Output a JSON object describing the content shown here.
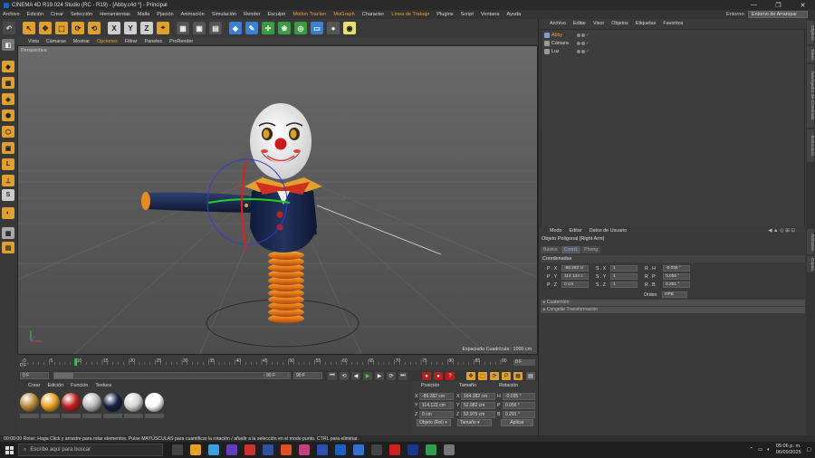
{
  "window": {
    "title": "CINEMA 4D R19.024 Studio (RC - R19) - [Abby.c4d *] - Principal",
    "controls": [
      "—",
      "❐",
      "✕"
    ]
  },
  "menubar": {
    "items": [
      "Archivo",
      "Edición",
      "Crear",
      "Selección",
      "Herramientas",
      "Malla",
      "Pjación",
      "Animación",
      "Simulación",
      "Render",
      "Esculpir",
      "Motion Tracker",
      "MoGraph",
      "Character",
      "Línea de Trabajo",
      "Plugins",
      "Script",
      "Ventana",
      "Ayuda"
    ],
    "entorno_label": "Entorno:",
    "entorno_value": "Entorno de Arranque"
  },
  "toolbar": {
    "buttons": [
      {
        "name": "undo",
        "glyph": "↶",
        "color": "#ddd",
        "bg": "#4a4a4a"
      },
      {
        "name": "live-select",
        "glyph": "↖",
        "color": "#222",
        "bg": "#e0a030"
      },
      {
        "name": "move",
        "glyph": "✥",
        "color": "#222",
        "bg": "#e0a030"
      },
      {
        "name": "scale",
        "glyph": "⬚",
        "color": "#222",
        "bg": "#e0a030"
      },
      {
        "name": "rotate",
        "glyph": "⟳",
        "color": "#222",
        "bg": "#e0a030"
      },
      {
        "name": "recent",
        "glyph": "⟲",
        "color": "#222",
        "bg": "#e0a030"
      },
      {
        "name": "x-axis",
        "glyph": "X",
        "color": "#222",
        "bg": "#cfcfcf"
      },
      {
        "name": "y-axis",
        "glyph": "Y",
        "color": "#222",
        "bg": "#cfcfcf"
      },
      {
        "name": "z-axis",
        "glyph": "Z",
        "color": "#222",
        "bg": "#cfcfcf"
      },
      {
        "name": "coord-system",
        "glyph": "⌖",
        "color": "#222",
        "bg": "#e0a030"
      },
      {
        "name": "render-region",
        "glyph": "▦",
        "color": "#eee",
        "bg": "#555"
      },
      {
        "name": "render-view",
        "glyph": "▣",
        "color": "#eee",
        "bg": "#555"
      },
      {
        "name": "render-settings",
        "glyph": "▤",
        "color": "#eee",
        "bg": "#555"
      },
      {
        "name": "cube",
        "glyph": "◈",
        "color": "#fff",
        "bg": "#3a80d0"
      },
      {
        "name": "pen",
        "glyph": "✎",
        "color": "#fff",
        "bg": "#3a80d0"
      },
      {
        "name": "subdivision",
        "glyph": "✣",
        "color": "#fff",
        "bg": "#3a9c40"
      },
      {
        "name": "cloner",
        "glyph": "❀",
        "color": "#fff",
        "bg": "#3a9c40"
      },
      {
        "name": "deformer",
        "glyph": "◎",
        "color": "#fff",
        "bg": "#3a9c40"
      },
      {
        "name": "scene",
        "glyph": "▭",
        "color": "#fff",
        "bg": "#3a80d0"
      },
      {
        "name": "camera",
        "glyph": "●",
        "color": "#fff",
        "bg": "#555"
      },
      {
        "name": "light",
        "glyph": "◉",
        "color": "#222",
        "bg": "#e8e070"
      }
    ]
  },
  "viewport": {
    "menu": [
      "Vista",
      "Cámaras",
      "Mostrar",
      "Opciones",
      "Filtrar",
      "Paneles",
      "ProRender"
    ],
    "label": "Perspectiva",
    "grid_info": "Espaciado Cuadrícula : 1000 cm"
  },
  "timeline": {
    "ticks": [
      "0",
      "5",
      "10",
      "15",
      "20",
      "25",
      "30",
      "35",
      "40",
      "45",
      "50",
      "55",
      "60",
      "65",
      "70",
      "75",
      "80",
      "85",
      "90"
    ],
    "current_frame": "0 F",
    "end_frame": "0 F"
  },
  "playbar": {
    "start": "0 F",
    "min": "0 F",
    "max": "90 F",
    "end": "90 F",
    "range_fill": 0.08
  },
  "materials": {
    "menu": [
      "Crear",
      "Edición",
      "Función",
      "Textura"
    ],
    "swatches": [
      "#b98a3a",
      "#e8a020",
      "#c02020",
      "#bbbbbb",
      "#152040",
      "#d5d5d5",
      "#ffffff"
    ]
  },
  "coordinates": {
    "headers": [
      "Posición",
      "Tamaño",
      "Rotación"
    ],
    "rows": [
      {
        "axis": "X",
        "pos": "-86.282 cm",
        "size_axis": "X",
        "size": "164.382 cm",
        "rot_axis": "H",
        "rot": "-0.035 °"
      },
      {
        "axis": "Y",
        "pos": "114.122 cm",
        "size_axis": "Y",
        "size": "52.982 cm",
        "rot_axis": "P",
        "rot": "0.056 °"
      },
      {
        "axis": "Z",
        "pos": "0 cm",
        "size_axis": "Z",
        "size": "52.975 cm",
        "rot_axis": "B",
        "rot": "0.291 °"
      }
    ],
    "mode": "Objeto (Rel) ▾",
    "size_mode": "Tamaño ▾",
    "apply": "Aplicar"
  },
  "status": "00:00:00   Rotar: Haga Click y arrastre para rotar elementos. Pulse MAYÚSCULAS para cuantificar la rotación / añadir a la selección en el modo punto. CTRL para eliminar.",
  "objects": {
    "menu": [
      "Archivo",
      "Editar",
      "Visor",
      "Objetos",
      "Etiquetas",
      "Favoritos"
    ],
    "items": [
      {
        "name": "Abby",
        "selected": true
      },
      {
        "name": "Cámara",
        "selected": false
      },
      {
        "name": "Luz",
        "selected": false
      }
    ]
  },
  "attributes": {
    "menu": [
      "Modo",
      "Editar",
      "Datos de Usuario"
    ],
    "title": "Objeto Poligonal [Right Arm]",
    "tabs": [
      {
        "label": "Básico",
        "active": false
      },
      {
        "label": "Coord.",
        "active": true
      },
      {
        "label": "Phong",
        "active": false
      }
    ],
    "section": "Coordenadas",
    "rows": [
      {
        "p_label": "P . X",
        "p": "-86.282 cr",
        "s_label": "S . X",
        "s": "1",
        "r_label": "R . H",
        "r": "-0.035 °"
      },
      {
        "p_label": "P . Y",
        "p": "114.122 c",
        "s_label": "S . Y",
        "s": "1",
        "r_label": "R . P",
        "r": "0.056 °"
      },
      {
        "p_label": "P . Z",
        "p": "0 cm",
        "s_label": "S . Z",
        "s": "1",
        "r_label": "R . B",
        "r": "0.291 °"
      }
    ],
    "order_label": "Orden",
    "order_value": "HPB",
    "collapsed": [
      "▸ Cuaternión",
      "▸ Congelar Transformación"
    ]
  },
  "side_tabs": [
    "Objetos",
    "Takes",
    "Navegador de Contenido",
    "Estructura"
  ],
  "side_tabs_lower": [
    "Atributos",
    "Capas"
  ],
  "taskbar": {
    "search": "Escribe aquí para buscar",
    "icons": [
      "#444",
      "#e8a020",
      "#3aa0e0",
      "#6040c0",
      "#d03030",
      "#3050a0",
      "#e05020",
      "#c04080",
      "#3050b0",
      "#1a60c0",
      "#3070d0",
      "#444",
      "#d02020",
      "#1a3a90",
      "#30a050",
      "#777"
    ],
    "time": "05:06 p. m.",
    "date": "06/09/2025"
  }
}
